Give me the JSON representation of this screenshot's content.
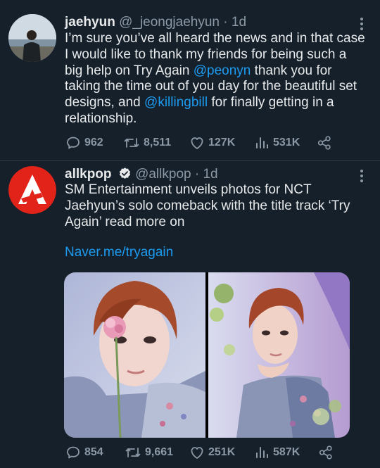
{
  "tweets": [
    {
      "name": "jaehyun",
      "handle": "@_jeongjaehyun",
      "time": "· 1d",
      "verified": false,
      "body": {
        "t1": "I’m sure you’ve all heard the news and in that case I would like to thank my friends for being such a big help on Try Again ",
        "m1": "@peonyn",
        "t2": " thank you for taking the time out of you day for the beautiful set designs, and ",
        "m2": "@killingbill",
        "t3": " for finally getting in a relationship."
      },
      "stats": {
        "replies": "962",
        "retweets": "8,511",
        "likes": "127K",
        "views": "531K"
      }
    },
    {
      "name": "allkpop",
      "handle": "@allkpop",
      "time": "· 1d",
      "verified": true,
      "body": "SM Entertainment  unveils photos for NCT Jaehyun’s solo comeback with the title track ‘Try Again’ read more on",
      "link": "Naver.me/tryagain",
      "stats": {
        "replies": "854",
        "retweets": "9,661",
        "likes": "251K",
        "views": "587K"
      }
    }
  ],
  "colors": {
    "background": "#15202b",
    "text": "#e7e9ea",
    "secondary": "#8b98a5",
    "accent": "#1d9bf0",
    "allkpop_red": "#e2231a"
  },
  "icons": [
    "reply-icon",
    "retweet-icon",
    "like-icon",
    "views-icon",
    "share-icon",
    "more-icon",
    "verified-badge-icon"
  ]
}
